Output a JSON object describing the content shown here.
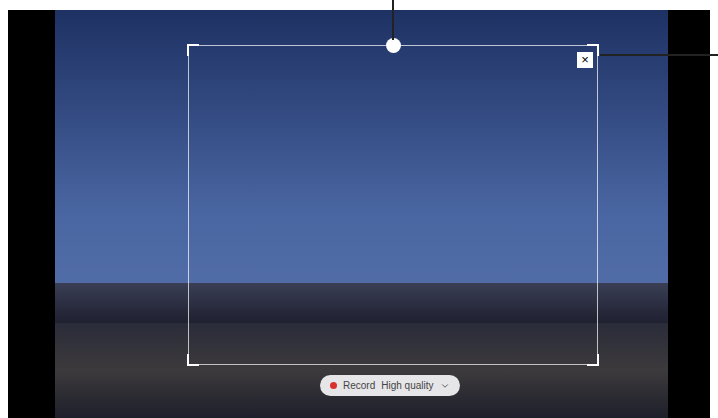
{
  "recording_frame": {
    "close_button": "×"
  },
  "record_pill": {
    "label": "Record",
    "quality": "High quality"
  }
}
